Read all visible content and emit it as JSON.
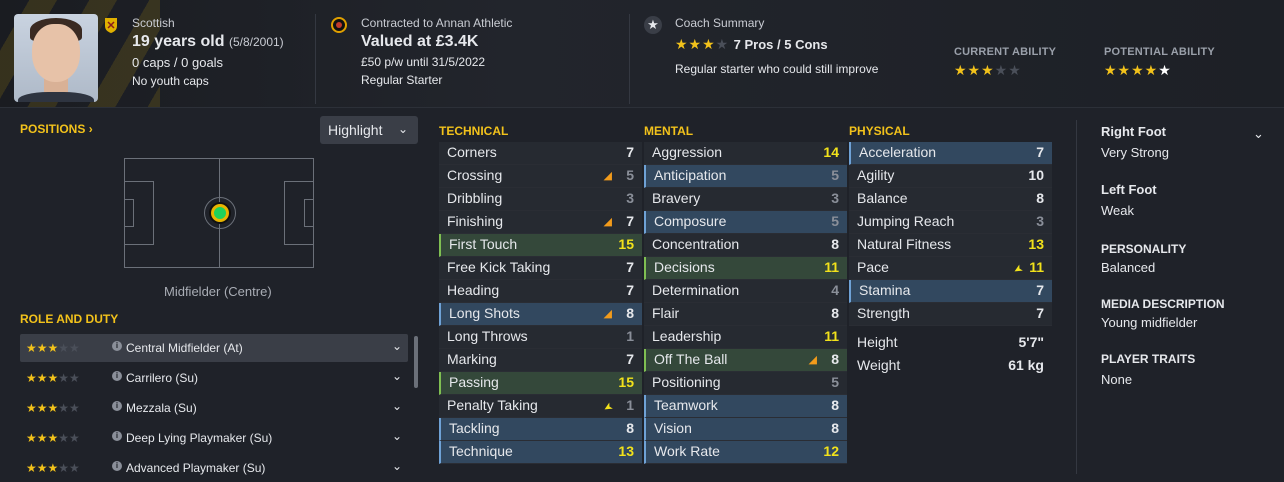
{
  "header": {
    "nationality": "Scottish",
    "age": "19 years old",
    "dob": "(5/8/2001)",
    "caps_goals": "0 caps / 0 goals",
    "youth_caps": "No youth caps",
    "contract": "Contracted to Annan Athletic",
    "value": "Valued at £3.4K",
    "wage": "£50 p/w until 31/5/2022",
    "status": "Regular Starter",
    "coach_title": "Coach Summary",
    "coach_stars": "★★★",
    "pros_cons": "7 Pros / 5 Cons",
    "coach_note": "Regular starter who could still improve",
    "current_ability_label": "CURRENT ABILITY",
    "current_ability_stars": 3,
    "potential_ability_label": "POTENTIAL ABILITY",
    "potential_ability_stars": 4
  },
  "positions": {
    "title": "POSITIONS",
    "highlight_label": "Highlight",
    "position_name": "Midfielder (Centre)",
    "role_title": "ROLE AND DUTY",
    "roles": [
      {
        "name": "Central Midfielder (At)",
        "stars": "★★★"
      },
      {
        "name": "Carrilero (Su)",
        "stars": "★★★"
      },
      {
        "name": "Mezzala (Su)",
        "stars": "★★★"
      },
      {
        "name": "Deep Lying Playmaker (Su)",
        "stars": "★★★"
      },
      {
        "name": "Advanced Playmaker (Su)",
        "stars": "★★★"
      }
    ]
  },
  "technical": {
    "title": "TECHNICAL",
    "rows": [
      {
        "name": "Corners",
        "value": "7"
      },
      {
        "name": "Crossing",
        "value": "5"
      },
      {
        "name": "Dribbling",
        "value": "3"
      },
      {
        "name": "Finishing",
        "value": "7"
      },
      {
        "name": "First Touch",
        "value": "15"
      },
      {
        "name": "Free Kick Taking",
        "value": "7"
      },
      {
        "name": "Heading",
        "value": "7"
      },
      {
        "name": "Long Shots",
        "value": "8"
      },
      {
        "name": "Long Throws",
        "value": "1"
      },
      {
        "name": "Marking",
        "value": "7"
      },
      {
        "name": "Passing",
        "value": "15"
      },
      {
        "name": "Penalty Taking",
        "value": "1"
      },
      {
        "name": "Tackling",
        "value": "8"
      },
      {
        "name": "Technique",
        "value": "13"
      }
    ]
  },
  "mental": {
    "title": "MENTAL",
    "rows": [
      {
        "name": "Aggression",
        "value": "14"
      },
      {
        "name": "Anticipation",
        "value": "5"
      },
      {
        "name": "Bravery",
        "value": "3"
      },
      {
        "name": "Composure",
        "value": "5"
      },
      {
        "name": "Concentration",
        "value": "8"
      },
      {
        "name": "Decisions",
        "value": "11"
      },
      {
        "name": "Determination",
        "value": "4"
      },
      {
        "name": "Flair",
        "value": "8"
      },
      {
        "name": "Leadership",
        "value": "11"
      },
      {
        "name": "Off The Ball",
        "value": "8"
      },
      {
        "name": "Positioning",
        "value": "5"
      },
      {
        "name": "Teamwork",
        "value": "8"
      },
      {
        "name": "Vision",
        "value": "8"
      },
      {
        "name": "Work Rate",
        "value": "12"
      }
    ]
  },
  "physical": {
    "title": "PHYSICAL",
    "rows": [
      {
        "name": "Acceleration",
        "value": "7"
      },
      {
        "name": "Agility",
        "value": "10"
      },
      {
        "name": "Balance",
        "value": "8"
      },
      {
        "name": "Jumping Reach",
        "value": "3"
      },
      {
        "name": "Natural Fitness",
        "value": "13"
      },
      {
        "name": "Pace",
        "value": "11"
      },
      {
        "name": "Stamina",
        "value": "7"
      },
      {
        "name": "Strength",
        "value": "7"
      }
    ],
    "height_label": "Height",
    "height": "5'7\"",
    "weight_label": "Weight",
    "weight": "61 kg"
  },
  "profile": {
    "right_foot_label": "Right Foot",
    "right_foot": "Very Strong",
    "left_foot_label": "Left Foot",
    "left_foot": "Weak",
    "personality_label": "PERSONALITY",
    "personality": "Balanced",
    "media_label": "MEDIA DESCRIPTION",
    "media": "Young midfielder",
    "traits_label": "PLAYER TRAITS",
    "traits": "None"
  }
}
